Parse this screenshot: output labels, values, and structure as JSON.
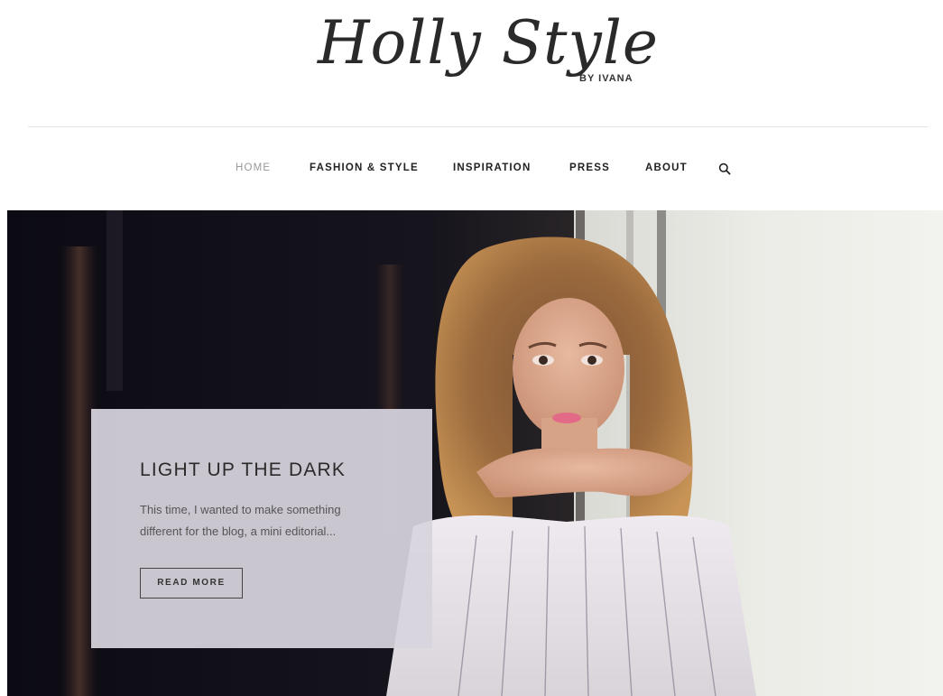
{
  "logo": {
    "script": "Holly Style",
    "subtitle": "BY IVANA"
  },
  "nav": {
    "items": [
      {
        "label": "HOME",
        "active": true
      },
      {
        "label": "FASHION & STYLE",
        "active": false
      },
      {
        "label": "INSPIRATION",
        "active": false
      },
      {
        "label": "PRESS",
        "active": false
      },
      {
        "label": "ABOUT",
        "active": false
      }
    ],
    "search_icon": "search-icon"
  },
  "hero": {
    "image": "woman-in-off-shoulder-striped-blouse-photo",
    "title": "LIGHT UP THE DARK",
    "excerpt": "This time, I wanted to make something different for the blog, a mini editorial...",
    "button_label": "READ MORE"
  },
  "colors": {
    "text": "#222222",
    "nav_active": "#999999",
    "card_bg": "#d7d4de",
    "hero_dark": "#111018",
    "hero_light": "#e9e9e4"
  }
}
